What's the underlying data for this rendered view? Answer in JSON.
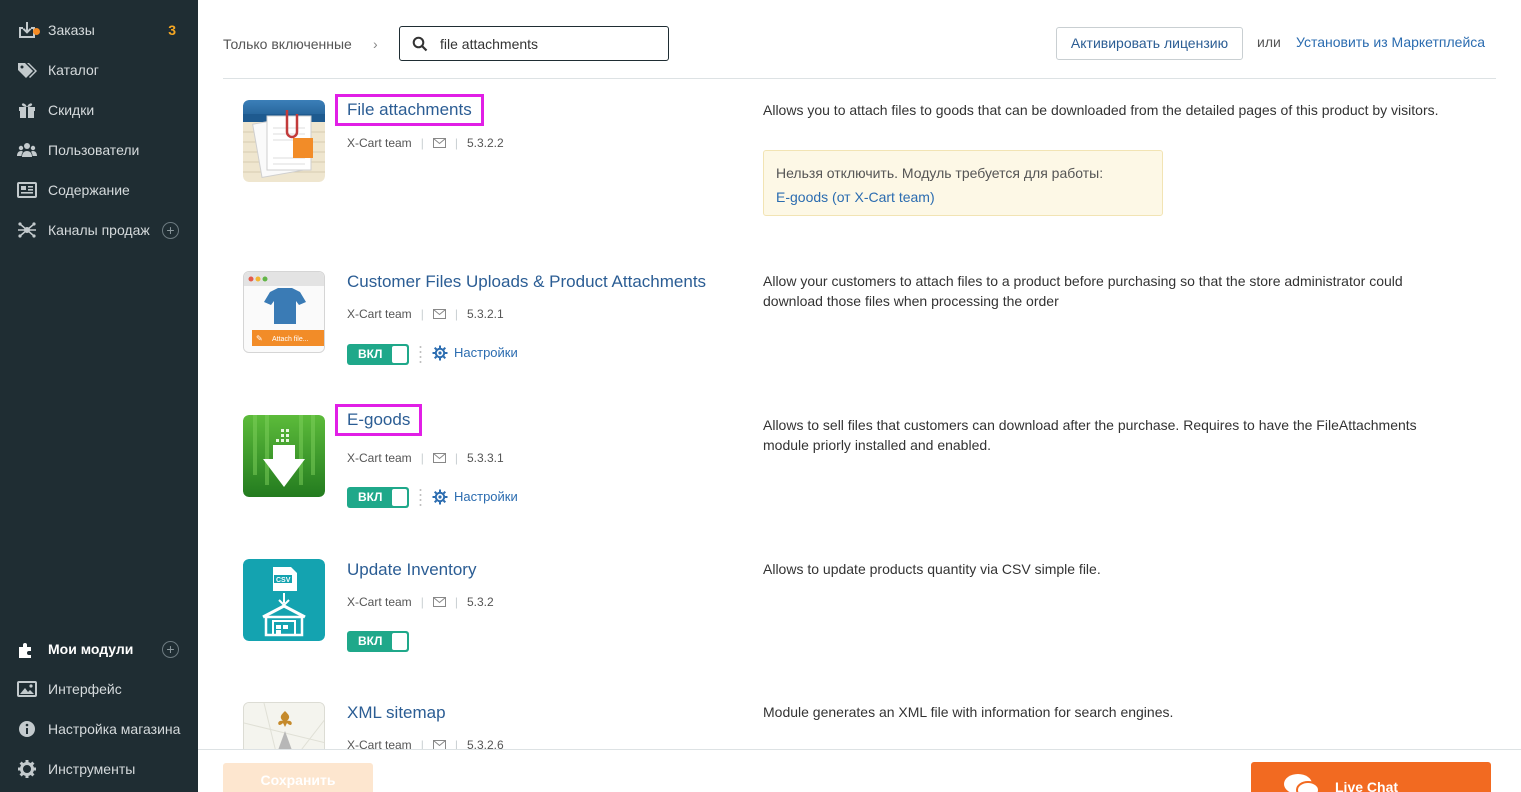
{
  "sidebar": {
    "items": [
      {
        "label": "Заказы",
        "icon": "orders-icon",
        "badge": "3"
      },
      {
        "label": "Каталог",
        "icon": "tags-icon"
      },
      {
        "label": "Скидки",
        "icon": "gift-icon"
      },
      {
        "label": "Пользователи",
        "icon": "users-icon"
      },
      {
        "label": "Содержание",
        "icon": "content-icon"
      },
      {
        "label": "Каналы продаж",
        "icon": "channels-icon"
      }
    ],
    "bottom_items": [
      {
        "label": "Мои модули",
        "icon": "puzzle-icon",
        "active": true
      },
      {
        "label": "Интерфейс",
        "icon": "image-icon"
      },
      {
        "label": "Настройка магазина",
        "icon": "info-icon"
      },
      {
        "label": "Инструменты",
        "icon": "gear-icon"
      }
    ]
  },
  "toolbar": {
    "filter_label": "Только включенные",
    "chevron": "›",
    "search_value": "file attachments",
    "license_button": "Активировать лицензию",
    "or_text": "или",
    "marketplace_link": "Установить из Маркетплейса"
  },
  "modules": [
    {
      "title": "File attachments",
      "author": "X-Cart team",
      "version": "5.3.2.2",
      "description": "Allows you to attach files to goods that can be downloaded from the detailed pages of this product by visitors.",
      "warning_text": "Нельзя отключить. Модуль требуется для работы:",
      "warning_link": "E-goods (от X-Cart team)",
      "icon": "file-attachments-icon"
    },
    {
      "title": "Customer Files Uploads & Product Attachments",
      "author": "X-Cart team",
      "version": "5.3.2.1",
      "description": "Allow your customers to attach files to a product before purchasing so that the store administrator could download those files when processing the order",
      "toggle": "ВКЛ",
      "settings": "Настройки",
      "image_caption": "Attach file...",
      "icon": "customer-files-icon"
    },
    {
      "title": "E-goods",
      "author": "X-Cart team",
      "version": "5.3.3.1",
      "description": "Allows to sell files that customers can download after the purchase. Requires to have the FileAttachments module priorly installed and enabled.",
      "toggle": "ВКЛ",
      "settings": "Настройки",
      "icon": "download-arrow-icon"
    },
    {
      "title": "Update Inventory",
      "author": "X-Cart team",
      "version": "5.3.2",
      "description": "Allows to update products quantity via CSV simple file.",
      "toggle": "ВКЛ",
      "image_caption": "CSV",
      "icon": "csv-warehouse-icon"
    },
    {
      "title": "XML sitemap",
      "author": "X-Cart team",
      "version": "5.3.2.6",
      "description": "Module generates an XML file with information for search engines.",
      "icon": "compass-map-icon"
    }
  ],
  "footer": {
    "save_button": "Сохранить",
    "live_chat": "Live Chat"
  },
  "colors": {
    "sidebar_bg": "#1f2d33",
    "link": "#2b5d94",
    "toggle_on": "#1fa88a",
    "highlight_box": "#e11fe6",
    "live_chat": "#f26a21",
    "badge": "#f5a623"
  }
}
